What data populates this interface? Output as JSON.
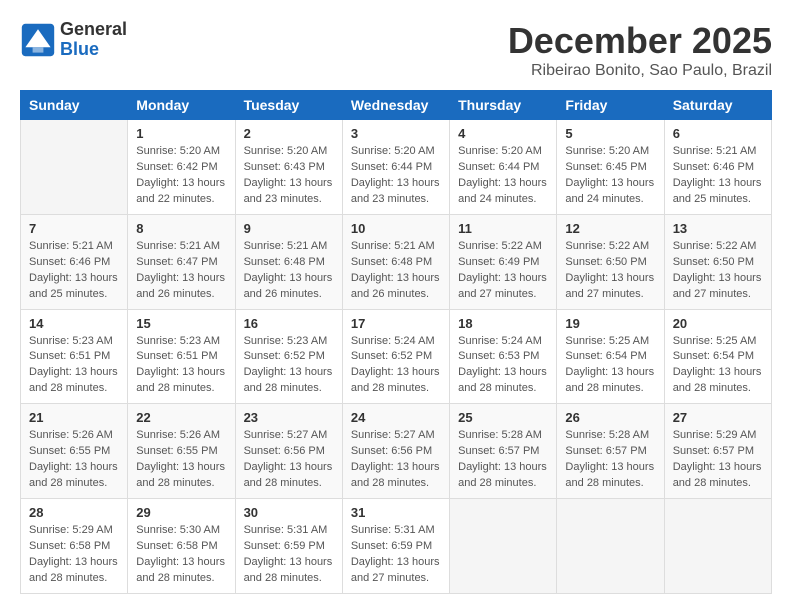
{
  "header": {
    "logo_line1": "General",
    "logo_line2": "Blue",
    "month_title": "December 2025",
    "subtitle": "Ribeirao Bonito, Sao Paulo, Brazil"
  },
  "days_of_week": [
    "Sunday",
    "Monday",
    "Tuesday",
    "Wednesday",
    "Thursday",
    "Friday",
    "Saturday"
  ],
  "weeks": [
    [
      {
        "day": "",
        "info": ""
      },
      {
        "day": "1",
        "info": "Sunrise: 5:20 AM\nSunset: 6:42 PM\nDaylight: 13 hours\nand 22 minutes."
      },
      {
        "day": "2",
        "info": "Sunrise: 5:20 AM\nSunset: 6:43 PM\nDaylight: 13 hours\nand 23 minutes."
      },
      {
        "day": "3",
        "info": "Sunrise: 5:20 AM\nSunset: 6:44 PM\nDaylight: 13 hours\nand 23 minutes."
      },
      {
        "day": "4",
        "info": "Sunrise: 5:20 AM\nSunset: 6:44 PM\nDaylight: 13 hours\nand 24 minutes."
      },
      {
        "day": "5",
        "info": "Sunrise: 5:20 AM\nSunset: 6:45 PM\nDaylight: 13 hours\nand 24 minutes."
      },
      {
        "day": "6",
        "info": "Sunrise: 5:21 AM\nSunset: 6:46 PM\nDaylight: 13 hours\nand 25 minutes."
      }
    ],
    [
      {
        "day": "7",
        "info": "Sunrise: 5:21 AM\nSunset: 6:46 PM\nDaylight: 13 hours\nand 25 minutes."
      },
      {
        "day": "8",
        "info": "Sunrise: 5:21 AM\nSunset: 6:47 PM\nDaylight: 13 hours\nand 26 minutes."
      },
      {
        "day": "9",
        "info": "Sunrise: 5:21 AM\nSunset: 6:48 PM\nDaylight: 13 hours\nand 26 minutes."
      },
      {
        "day": "10",
        "info": "Sunrise: 5:21 AM\nSunset: 6:48 PM\nDaylight: 13 hours\nand 26 minutes."
      },
      {
        "day": "11",
        "info": "Sunrise: 5:22 AM\nSunset: 6:49 PM\nDaylight: 13 hours\nand 27 minutes."
      },
      {
        "day": "12",
        "info": "Sunrise: 5:22 AM\nSunset: 6:50 PM\nDaylight: 13 hours\nand 27 minutes."
      },
      {
        "day": "13",
        "info": "Sunrise: 5:22 AM\nSunset: 6:50 PM\nDaylight: 13 hours\nand 27 minutes."
      }
    ],
    [
      {
        "day": "14",
        "info": "Sunrise: 5:23 AM\nSunset: 6:51 PM\nDaylight: 13 hours\nand 28 minutes."
      },
      {
        "day": "15",
        "info": "Sunrise: 5:23 AM\nSunset: 6:51 PM\nDaylight: 13 hours\nand 28 minutes."
      },
      {
        "day": "16",
        "info": "Sunrise: 5:23 AM\nSunset: 6:52 PM\nDaylight: 13 hours\nand 28 minutes."
      },
      {
        "day": "17",
        "info": "Sunrise: 5:24 AM\nSunset: 6:52 PM\nDaylight: 13 hours\nand 28 minutes."
      },
      {
        "day": "18",
        "info": "Sunrise: 5:24 AM\nSunset: 6:53 PM\nDaylight: 13 hours\nand 28 minutes."
      },
      {
        "day": "19",
        "info": "Sunrise: 5:25 AM\nSunset: 6:54 PM\nDaylight: 13 hours\nand 28 minutes."
      },
      {
        "day": "20",
        "info": "Sunrise: 5:25 AM\nSunset: 6:54 PM\nDaylight: 13 hours\nand 28 minutes."
      }
    ],
    [
      {
        "day": "21",
        "info": "Sunrise: 5:26 AM\nSunset: 6:55 PM\nDaylight: 13 hours\nand 28 minutes."
      },
      {
        "day": "22",
        "info": "Sunrise: 5:26 AM\nSunset: 6:55 PM\nDaylight: 13 hours\nand 28 minutes."
      },
      {
        "day": "23",
        "info": "Sunrise: 5:27 AM\nSunset: 6:56 PM\nDaylight: 13 hours\nand 28 minutes."
      },
      {
        "day": "24",
        "info": "Sunrise: 5:27 AM\nSunset: 6:56 PM\nDaylight: 13 hours\nand 28 minutes."
      },
      {
        "day": "25",
        "info": "Sunrise: 5:28 AM\nSunset: 6:57 PM\nDaylight: 13 hours\nand 28 minutes."
      },
      {
        "day": "26",
        "info": "Sunrise: 5:28 AM\nSunset: 6:57 PM\nDaylight: 13 hours\nand 28 minutes."
      },
      {
        "day": "27",
        "info": "Sunrise: 5:29 AM\nSunset: 6:57 PM\nDaylight: 13 hours\nand 28 minutes."
      }
    ],
    [
      {
        "day": "28",
        "info": "Sunrise: 5:29 AM\nSunset: 6:58 PM\nDaylight: 13 hours\nand 28 minutes."
      },
      {
        "day": "29",
        "info": "Sunrise: 5:30 AM\nSunset: 6:58 PM\nDaylight: 13 hours\nand 28 minutes."
      },
      {
        "day": "30",
        "info": "Sunrise: 5:31 AM\nSunset: 6:59 PM\nDaylight: 13 hours\nand 28 minutes."
      },
      {
        "day": "31",
        "info": "Sunrise: 5:31 AM\nSunset: 6:59 PM\nDaylight: 13 hours\nand 27 minutes."
      },
      {
        "day": "",
        "info": ""
      },
      {
        "day": "",
        "info": ""
      },
      {
        "day": "",
        "info": ""
      }
    ]
  ]
}
